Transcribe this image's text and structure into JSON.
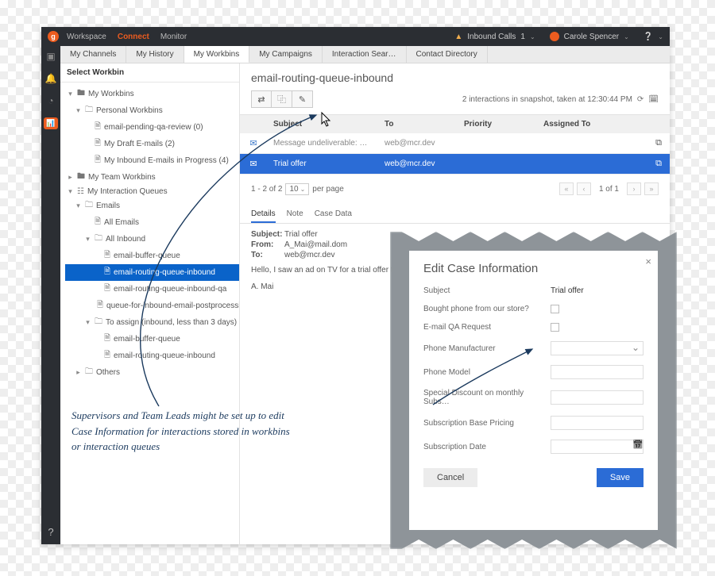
{
  "topnav": {
    "workspace": "Workspace",
    "connect": "Connect",
    "monitor": "Monitor"
  },
  "alert_label": "Inbound Calls",
  "alert_count": "1",
  "user_name": "Carole Spencer",
  "tabs": [
    "My Channels",
    "My History",
    "My Workbins",
    "My Campaigns",
    "Interaction Sear…",
    "Contact Directory"
  ],
  "active_tab_index": 2,
  "sidebar_title": "Select Workbin",
  "tree": {
    "my_workbins": "My Workbins",
    "personal": "Personal Workbins",
    "pending": "email-pending-qa-review (0)",
    "drafts": "My Draft E-mails (2)",
    "inprog": "My Inbound E-mails in Progress (4)",
    "team": "My Team Workbins",
    "queues": "My Interaction Queues",
    "emails": "Emails",
    "all": "All Emails",
    "allinbound": "All Inbound",
    "buffer": "email-buffer-queue",
    "routing": "email-routing-queue-inbound",
    "routing_qa": "email-routing-queue-inbound-qa",
    "postproc": "queue-for-inbound-email-postprocessing",
    "toassign": "To assign (inbound, less than 3 days)",
    "buffer2": "email-buffer-queue",
    "routing2": "email-routing-queue-inbound",
    "others": "Others"
  },
  "main_title": "email-routing-queue-inbound",
  "snapshot_text": "2 interactions in snapshot, taken at 12:30:44 PM",
  "columns": {
    "subject": "Subject",
    "to": "To",
    "priority": "Priority",
    "assigned": "Assigned To"
  },
  "rows": [
    {
      "subject": "Message undeliverable: F…",
      "to": "web@mcr.dev",
      "priority": "",
      "assigned": ""
    },
    {
      "subject": "Trial offer",
      "to": "web@mcr.dev",
      "priority": "",
      "assigned": ""
    }
  ],
  "pager": {
    "range": "1 - 2 of 2",
    "pp": "10",
    "pp_label": "per page",
    "page": "1 of 1"
  },
  "detail_tabs": [
    "Details",
    "Note",
    "Case Data"
  ],
  "detail": {
    "subject_k": "Subject:",
    "subject_v": "Trial offer",
    "from_k": "From:",
    "from_v": "A_Mai@mail.dom",
    "to_k": "To:",
    "to_v": "web@mcr.dev",
    "msg": "Hello, I saw an ad on TV for a trial offer that you ha",
    "sig": "A. Mai"
  },
  "dialog": {
    "title": "Edit Case Information",
    "subject_l": "Subject",
    "subject_v": "Trial offer",
    "bought_l": "Bought phone from our store?",
    "qa_l": "E-mail QA Request",
    "mfr_l": "Phone Manufacturer",
    "model_l": "Phone Model",
    "disc_l": "Special Discount on monthly Subs…",
    "base_l": "Subscription Base Pricing",
    "date_l": "Subscription Date",
    "cancel": "Cancel",
    "save": "Save"
  },
  "annotation": "Supervisors and Team Leads might be set up to edit Case Information for interactions stored in workbins or interaction queues"
}
